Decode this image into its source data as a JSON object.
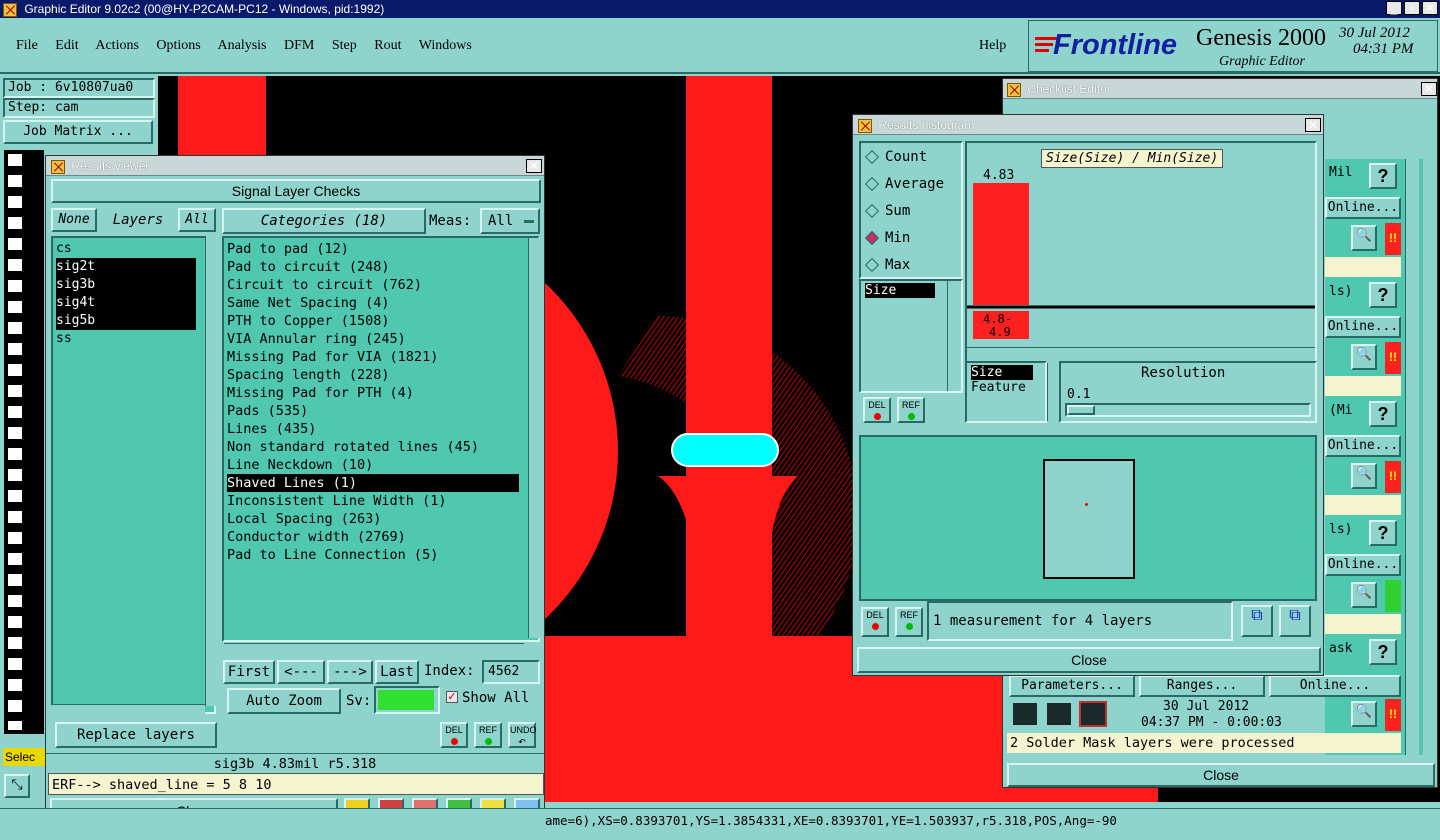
{
  "app": {
    "title": "Graphic Editor 9.02c2 (00@HY-P2CAM-PC12 - Windows, pid:1992)",
    "menu": [
      "File",
      "Edit",
      "Actions",
      "Options",
      "Analysis",
      "DFM",
      "Step",
      "Rout",
      "Windows"
    ],
    "help": "Help",
    "brand": "Frontline",
    "product": "Genesis 2000",
    "subtitle": "Graphic Editor",
    "date": "30 Jul 2012",
    "time": "04:31 PM"
  },
  "left": {
    "job": "Job : 6v10807ua0",
    "step": "Step: cam",
    "job_matrix": "Job Matrix ...",
    "select": "Selec"
  },
  "results_viewer": {
    "title": "Results viewer",
    "header": "Signal Layer Checks",
    "none": "None",
    "layers_label": "Layers",
    "all": "All",
    "categories": "Categories (18)",
    "meas_label": "Meas:",
    "meas_value": "All",
    "layers": [
      "cs",
      "sig2t",
      "sig3b",
      "sig4t",
      "sig5b",
      "ss"
    ],
    "selected_layers": [
      "sig2t",
      "sig3b",
      "sig4t",
      "sig5b"
    ],
    "items": [
      "Pad to pad (12)",
      "Pad to circuit (248)",
      "Circuit to circuit (762)",
      "Same Net Spacing (4)",
      "PTH to Copper (1508)",
      "VIA Annular ring (245)",
      "Missing Pad for VIA (1821)",
      "Spacing length (228)",
      "Missing Pad for PTH (4)",
      "Pads (535)",
      "Lines (435)",
      "Non standard rotated lines (45)",
      "Line Neckdown (10)",
      "Shaved Lines (1)",
      "Inconsistent Line Width (1)",
      "Local Spacing (263)",
      "Conductor width (2769)",
      "Pad to Line Connection (5)"
    ],
    "selected_item": "Shaved Lines (1)",
    "first": "First",
    "prev": "<---",
    "next": "--->",
    "last": "Last",
    "index_label": "Index:",
    "index_value": "4562",
    "auto_zoom": "Auto Zoom",
    "sv_label": "Sv:",
    "show_all": "Show All",
    "replace_layers": "Replace layers",
    "del": "DEL",
    "ref": "REF",
    "undo": "UNDO",
    "status": "sig3b 4.83mil  r5.318",
    "erf": "ERF--> shaved_line = 5 8 10",
    "close": "Close"
  },
  "histogram": {
    "title": "Results histogram",
    "options": [
      "Count",
      "Average",
      "Sum",
      "Min",
      "Max"
    ],
    "selected_option": "Min",
    "chart_title": "Size(Size) / Min(Size)",
    "attr_list": [
      "Size"
    ],
    "axis_list": [
      "Size",
      "Feature"
    ],
    "resolution_label": "Resolution",
    "resolution_value": "0.1",
    "measurement": "1 measurement for 4 layers",
    "close": "Close",
    "del": "DEL",
    "ref": "REF"
  },
  "chart_data": {
    "type": "bar",
    "title": "Size(Size) / Min(Size)",
    "categories": [
      "4.8-4.9"
    ],
    "values": [
      4.83
    ],
    "data_labels": [
      "4.83"
    ],
    "bar_color": "#ff2020"
  },
  "checklist": {
    "title": "Checklist Editor",
    "rows": [
      {
        "label": "Mil",
        "online": "Online...",
        "status_color": "#ff2020"
      },
      {
        "label": "ls)",
        "online": "Online...",
        "status_color": "#ff2020"
      },
      {
        "label": "(Mi",
        "online": "Online...",
        "status_color": "#ff2020"
      },
      {
        "label": "ls)",
        "online": "Online...",
        "status_color": "#30d030"
      },
      {
        "label": "ask",
        "online": "Online...",
        "status_color": "#ff2020"
      }
    ],
    "parameters": "Parameters...",
    "ranges": "Ranges...",
    "online": "Online...",
    "run_date": "30 Jul 2012",
    "run_time": "04:37 PM - 0:00:03",
    "message": "2 Solder Mask layers were processed",
    "close": "Close"
  },
  "statusbar": "ame=6),XS=0.8393701,YS=1.3854331,XE=0.8393701,YE=1.503937,r5.318,POS,Ang=-90"
}
